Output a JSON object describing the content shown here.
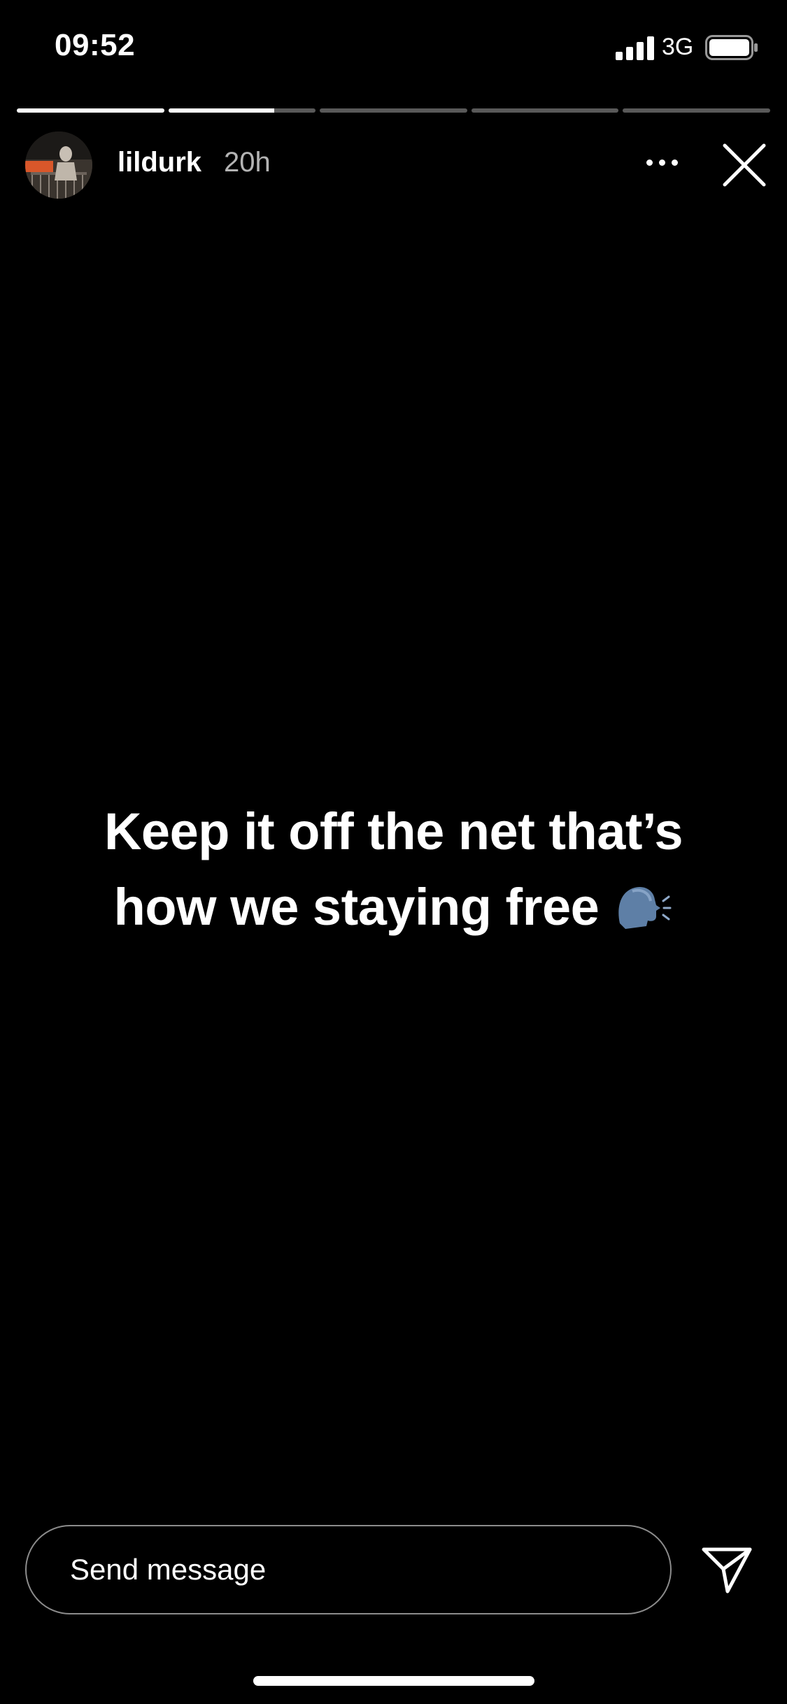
{
  "status_bar": {
    "time": "09:52",
    "network": "3G",
    "signal_icon": "cellular-signal-icon",
    "battery_icon": "battery-icon"
  },
  "story": {
    "progress": [
      1.0,
      0.72,
      0.0,
      0.0,
      0.0
    ],
    "username": "lildurk",
    "posted_ago": "20h",
    "avatar_icon": "profile-avatar",
    "text_line_1": "Keep it off the net that’s",
    "text_line_2": "how we staying free",
    "emoji": "speaking-head-emoji"
  },
  "footer": {
    "message_placeholder": "Send message",
    "send_icon": "paper-plane-icon"
  },
  "colors": {
    "background": "#000000",
    "foreground": "#ffffff"
  }
}
